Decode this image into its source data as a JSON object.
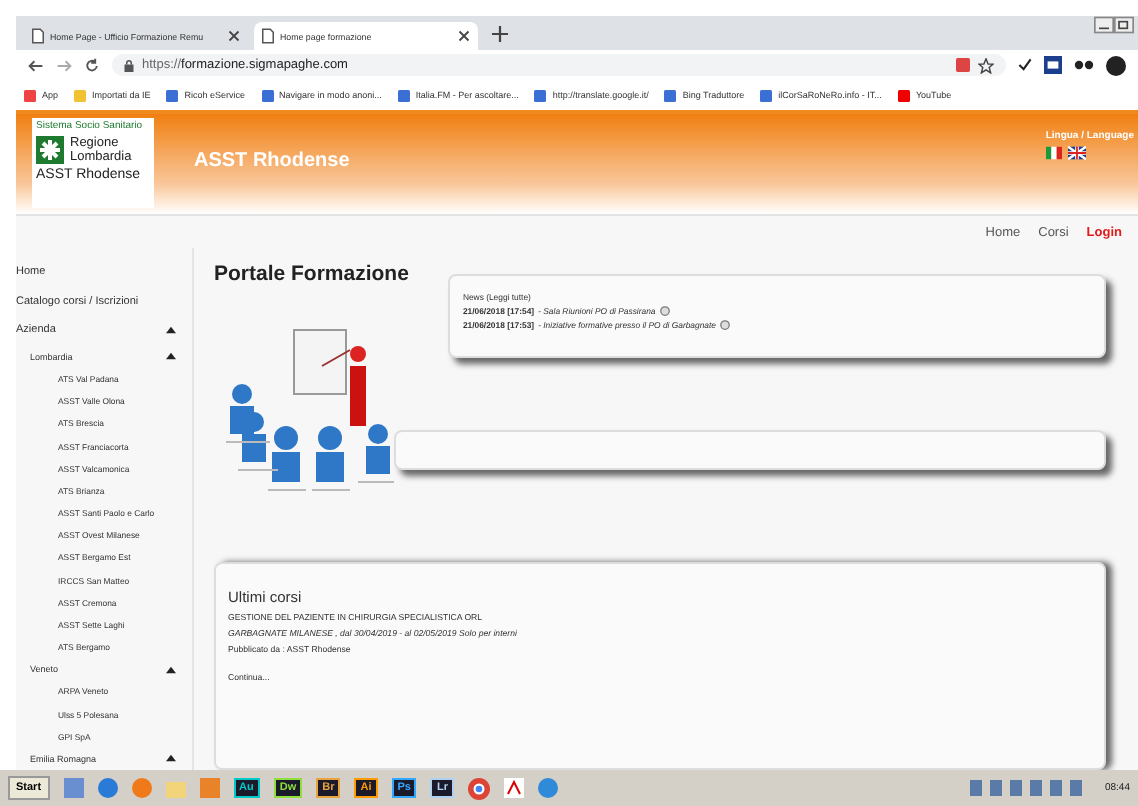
{
  "browser": {
    "tabs": [
      {
        "title": "Home Page - Ufficio Formazione Remu",
        "selected": false
      },
      {
        "title": "Home page formazione",
        "selected": true
      }
    ],
    "url_prefix": "https://",
    "url_host": "formazione.sigmapaghe.com",
    "bookmarks": [
      "App",
      "Importati da IE",
      "Ricoh eService",
      "Navigare in modo anoni...",
      "Italia.FM - Per ascoltare...",
      "http://translate.google.it/",
      "Bing Traduttore",
      "ilCorSaRoNeRo.info - IT...",
      "YouTube"
    ]
  },
  "header": {
    "logo_top": "Sistema Socio Sanitario",
    "logo_region_1": "Regione",
    "logo_region_2": "Lombardia",
    "logo_bottom": "ASST Rhodense",
    "title": "ASST Rhodense",
    "language_label": "Lingua / Language"
  },
  "nav": [
    {
      "label": "Home",
      "kind": "normal"
    },
    {
      "label": "Corsi",
      "kind": "normal"
    },
    {
      "label": "Login",
      "kind": "accent"
    }
  ],
  "sidebar": {
    "items": [
      {
        "label": "Home"
      },
      {
        "label": "Catalogo corsi / Iscrizioni"
      },
      {
        "label": "Azienda",
        "expanded": true,
        "children": [
          {
            "label": "Lombardia",
            "expanded": true,
            "children": [
              {
                "label": "ATS Val Padana"
              },
              {
                "label": "ASST Valle Olona"
              },
              {
                "label": "ATS Brescia"
              },
              {
                "label": "ASST Franciacorta"
              },
              {
                "label": "ASST Valcamonica"
              },
              {
                "label": "ATS Brianza"
              },
              {
                "label": "ASST Santi Paolo e Carlo"
              },
              {
                "label": "ASST Ovest Milanese"
              },
              {
                "label": "ASST Bergamo Est"
              },
              {
                "label": "IRCCS San Matteo"
              },
              {
                "label": "ASST Cremona"
              },
              {
                "label": "ASST Sette Laghi"
              },
              {
                "label": "ATS Bergamo"
              }
            ]
          },
          {
            "label": "Veneto",
            "expanded": true,
            "children": [
              {
                "label": "ARPA Veneto"
              },
              {
                "label": "Ulss 5 Polesana"
              },
              {
                "label": "GPI SpA"
              }
            ]
          },
          {
            "label": "Emilia Romagna",
            "expanded": true
          }
        ]
      }
    ]
  },
  "main": {
    "title": "Portale Formazione",
    "news": {
      "heading": "News (Leggi tutte)",
      "items": [
        {
          "date": "21/06/2018 [17:54]",
          "text": "- *Sala Riunioni PO di Passirana*"
        },
        {
          "date": "21/06/2018 [17:53]",
          "text": "- *Iniziative formative presso il PO di Garbagnate*"
        }
      ]
    },
    "latest": {
      "heading": "Ultimi corsi",
      "course": "GESTIONE DEL PAZIENTE IN CHIRURGIA SPECIALISTICA ORL",
      "details": "GARBAGNATE MILANESE , dal 30/04/2019 - al 02/05/2019 Solo per interni",
      "publisher": "Pubblicato da : ASST Rhodense",
      "more": "Continua..."
    }
  },
  "taskbar": {
    "start": "Start",
    "apps": [
      {
        "label": "Au",
        "color": "#00c8c8"
      },
      {
        "label": "Dw",
        "color": "#8fe03c"
      },
      {
        "label": "Br",
        "color": "#e8a33c"
      },
      {
        "label": "Ai",
        "color": "#ff9a00"
      },
      {
        "label": "Ps",
        "color": "#31a8ff"
      },
      {
        "label": "Lr",
        "color": "#b0d0f0"
      }
    ],
    "clock": "08:44"
  }
}
